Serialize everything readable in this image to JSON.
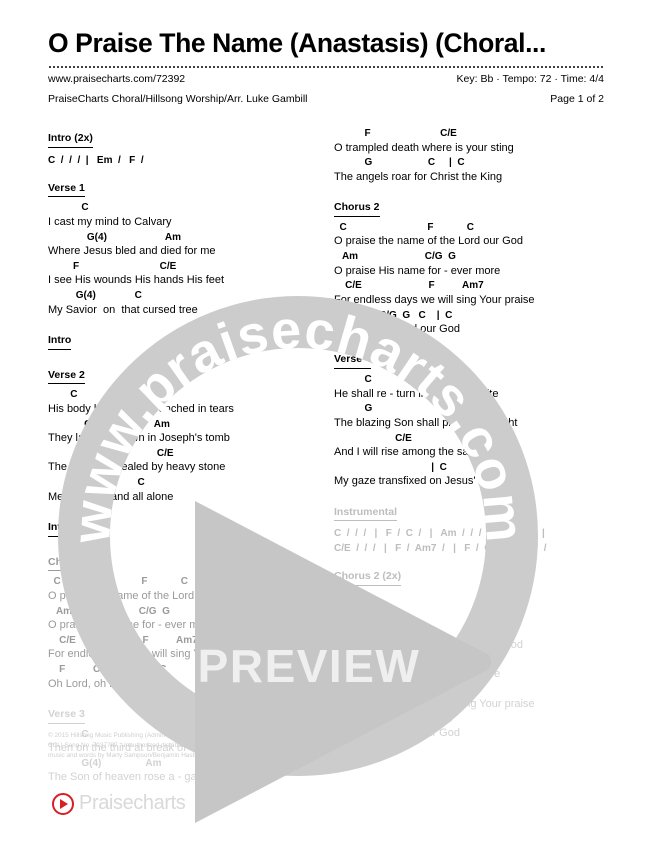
{
  "header": {
    "title": "O Praise The Name (Anastasis) (Choral...",
    "url": "www.praisecharts.com/72392",
    "credits": "PraiseCharts Choral/Hillsong Worship/Arr. Luke Gambill",
    "key_tempo_time": "Key: Bb · Tempo: 72 · Time: 4/4",
    "page_indicator": "Page 1 of 2"
  },
  "left_column": [
    {
      "label": "Intro (2x)",
      "fade": "f1",
      "progression": "C  /  /  /  |   Em  /   F  /",
      "lines": []
    },
    {
      "label": "Verse 1",
      "fade": "f1",
      "lines": [
        {
          "chords": "            C",
          "lyric": "I cast my mind to Calvary"
        },
        {
          "chords": "              G(4)                     Am",
          "lyric": "Where Jesus bled and died for me"
        },
        {
          "chords": "         F                             C/E",
          "lyric": "I see His wounds His hands His feet"
        },
        {
          "chords": "          G(4)              C",
          "lyric": "My Savior  on  that cursed tree"
        }
      ]
    },
    {
      "label": "Intro",
      "fade": "f1",
      "lines": []
    },
    {
      "label": "Verse 2",
      "fade": "f1",
      "lines": [
        {
          "chords": "        C",
          "lyric": "His body bound and drenched in tears"
        },
        {
          "chords": "             G(4)                  Am",
          "lyric": "They laid Him down in Joseph's tomb"
        },
        {
          "chords": "             F                        C/E",
          "lyric": "The entrance sealed by heavy stone"
        },
        {
          "chords": "         G(4)                C",
          "lyric": "Messiah still and all alone"
        }
      ]
    },
    {
      "label": "Intro",
      "fade": "f1",
      "lines": []
    },
    {
      "label": "Chorus 1",
      "fade": "f2",
      "lines": [
        {
          "chords": "  C                             F            C",
          "lyric": "O praise the name of the Lord our God"
        },
        {
          "chords": "   Am                        C/G  G",
          "lyric": "O praise His name for - ever more"
        },
        {
          "chords": "    C/E                        F          Am7",
          "lyric": "For endless days we will sing Your praise"
        },
        {
          "chords": "    F          C/G  G   C    |  C",
          "lyric": "Oh Lord, oh Lord our God"
        }
      ]
    },
    {
      "label": "Verse 3",
      "fade": "f4",
      "lines": [
        {
          "chords": "            C",
          "lyric": "Then on the third at break of dawn"
        },
        {
          "chords": "            G(4)                Am",
          "lyric": "The Son of heaven rose a - gain"
        }
      ]
    }
  ],
  "right_column": [
    {
      "label": "",
      "fade": "f1",
      "lines": [
        {
          "chords": "           F                         C/E",
          "lyric": "O trampled death where is your sting"
        },
        {
          "chords": "           G                    C     |  C",
          "lyric": "The angels roar for Christ the King"
        }
      ]
    },
    {
      "label": "Chorus 2",
      "fade": "f1",
      "lines": [
        {
          "chords": "  C                             F            C",
          "lyric": "O praise the name of the Lord our God"
        },
        {
          "chords": "   Am                        C/G  G",
          "lyric": "O praise His name for - ever more"
        },
        {
          "chords": "    C/E                        F          Am7",
          "lyric": "For endless days we will sing Your praise"
        },
        {
          "chords": "    F          C/G  G   C    |  C",
          "lyric": "Oh Lord, oh Lord our God"
        }
      ]
    },
    {
      "label": "Verse 4",
      "fade": "f1",
      "lines": [
        {
          "chords": "           C",
          "lyric": "He shall re - turn in robes of white"
        },
        {
          "chords": "           G                         Am",
          "lyric": "The blazing Son shall pierce the night"
        },
        {
          "chords": "                      C/E",
          "lyric": "And I will rise among the saints"
        },
        {
          "chords": "                                   |  C",
          "lyric": "My gaze transfixed on Jesus' face"
        }
      ]
    },
    {
      "label": "Instrumental",
      "fade": "f3",
      "progression_lines": [
        "C  /  /  /   |   F  /  C  /   |   Am  /  /  /   |   F  /  C  /  |",
        "C/E  /  /  /   |   F  /  Am7  /   |   F  /  C  /  |  G  /  /  /"
      ],
      "lines": []
    },
    {
      "label": "Chorus 2 (2x)",
      "fade": "f3",
      "lines": []
    },
    {
      "label": "Chorus 3",
      "fade": "f4",
      "lines": [
        {
          "chords": "  C                             F            C",
          "lyric": "O praise the name of the Lord our God"
        },
        {
          "chords": "   Am                        C/G  G",
          "lyric": "O praise His name for - ever more"
        },
        {
          "chords": "    C/E                        F          Am7",
          "lyric": "For endless days we will sing Your praise"
        },
        {
          "chords": "    F          C/G  G   C    |  C",
          "lyric": "Oh Lord, oh Lord our God"
        }
      ]
    }
  ],
  "copyright": "© 2015 Hillsong Music Publishing (Admin Capitol CMG)\nCCLI Song No. 7037787  Unauthorized distribution is prohibited.\nmusic and words by Marty Sampson/Benjamin Hastings/Dean Ussher",
  "watermark": {
    "ring_text": "www.praisecharts.com",
    "ring_color": "#cccccc",
    "ring_text_color": "#ffffff"
  },
  "preview_overlay": {
    "label": "PREVIEW",
    "play_color": "#c6c6c6",
    "label_color": "#efefef"
  },
  "footer": {
    "logo_text": "Praisecharts",
    "logo_accent": "#d81f26"
  }
}
